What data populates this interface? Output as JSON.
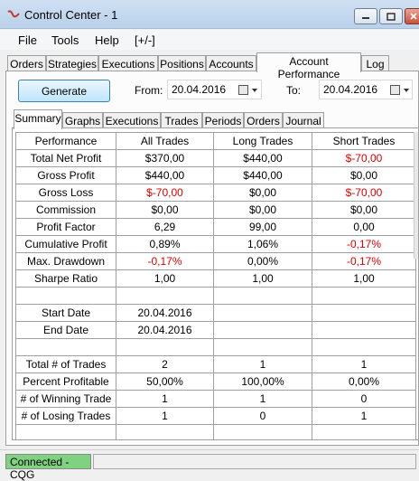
{
  "window": {
    "title": "Control Center - 1"
  },
  "menu": [
    "File",
    "Tools",
    "Help",
    "[+/-]"
  ],
  "top_tabs": [
    "Orders",
    "Strategies",
    "Executions",
    "Positions",
    "Accounts",
    "Account Performance",
    "Log"
  ],
  "toolbar": {
    "generate_label": "Generate",
    "from_label": "From:",
    "from_value": "20.04.2016",
    "to_label": "To:",
    "to_value": "20.04.2016"
  },
  "sub_tabs": [
    "Summary",
    "Graphs",
    "Executions",
    "Trades",
    "Periods",
    "Orders",
    "Journal"
  ],
  "table": {
    "headers": [
      "Performance",
      "All Trades",
      "Long Trades",
      "Short Trades"
    ],
    "rows": [
      [
        "Total Net Profit",
        "$370,00",
        "$440,00",
        "$-70,00"
      ],
      [
        "Gross Profit",
        "$440,00",
        "$440,00",
        "$0,00"
      ],
      [
        "Gross Loss",
        "$-70,00",
        "$0,00",
        "$-70,00"
      ],
      [
        "Commission",
        "$0,00",
        "$0,00",
        "$0,00"
      ],
      [
        "Profit Factor",
        "6,29",
        "99,00",
        "0,00"
      ],
      [
        "Cumulative Profit",
        "0,89%",
        "1,06%",
        "-0,17%"
      ],
      [
        "Max. Drawdown",
        "-0,17%",
        "0,00%",
        "-0,17%"
      ],
      [
        "Sharpe Ratio",
        "1,00",
        "1,00",
        "1,00"
      ],
      [
        "",
        "",
        "",
        ""
      ],
      [
        "Start Date",
        "20.04.2016",
        "",
        ""
      ],
      [
        "End Date",
        "20.04.2016",
        "",
        ""
      ],
      [
        "",
        "",
        "",
        ""
      ],
      [
        "Total # of Trades",
        "2",
        "1",
        "1"
      ],
      [
        "Percent Profitable",
        "50,00%",
        "100,00%",
        "0,00%"
      ],
      [
        "# of Winning Trade",
        "1",
        "1",
        "0"
      ],
      [
        "# of Losing Trades",
        "1",
        "0",
        "1"
      ],
      [
        "",
        "",
        "",
        ""
      ]
    ]
  },
  "status": {
    "connection": "Connected - CQG"
  },
  "colors": {
    "negative": "#e00000",
    "connected_bg": "#7fd27f"
  }
}
